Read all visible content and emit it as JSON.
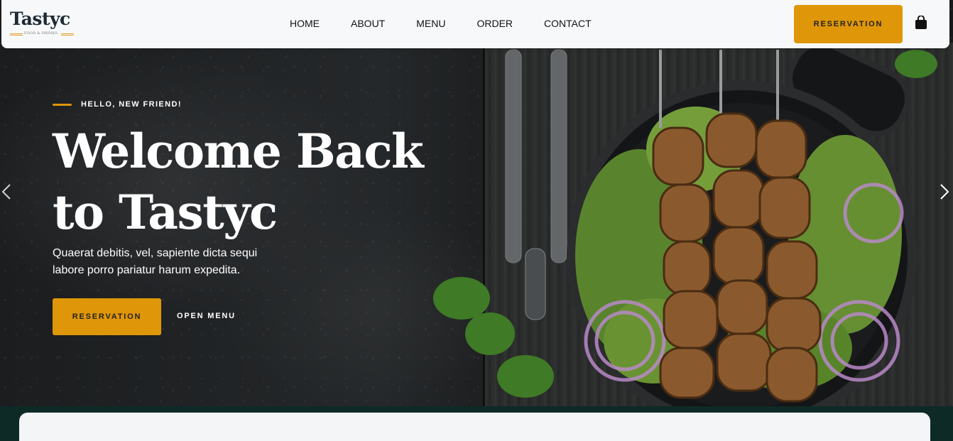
{
  "brand": {
    "name": "Tastyc",
    "tagline": "FOOD & DRINKS",
    "accent_color": "#df9609"
  },
  "nav": {
    "links": [
      "HOME",
      "ABOUT",
      "MENU",
      "ORDER",
      "CONTACT"
    ],
    "reservation_label": "RESERVATION",
    "cart_icon": "shopping-bag-icon"
  },
  "hero": {
    "eyebrow": "HELLO, NEW FRIEND!",
    "title_line1": "Welcome Back",
    "title_line2": "to Tastyc",
    "description": "Quaerat debitis, vel, sapiente dicta sequi labore porro pariatur harum expedita.",
    "reservation_label": "RESERVATION",
    "open_menu_label": "OPEN MENU",
    "prev_icon": "chevron-left-icon",
    "next_icon": "chevron-right-icon"
  }
}
